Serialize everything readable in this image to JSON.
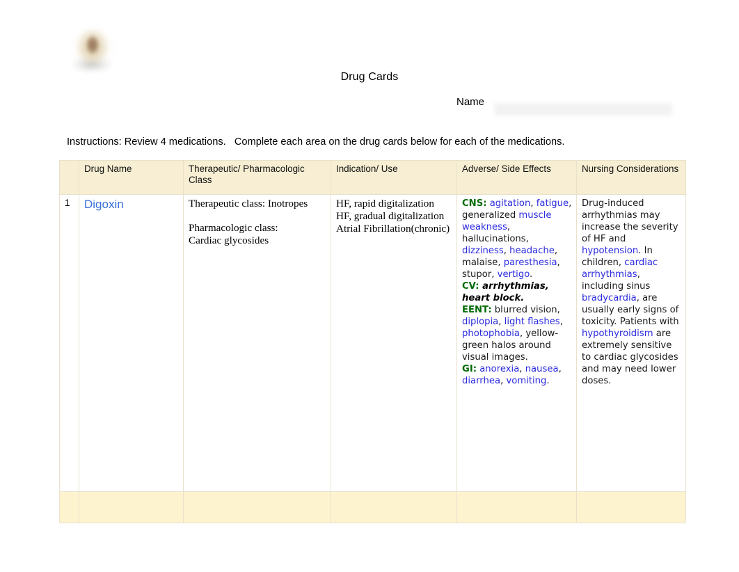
{
  "document": {
    "title": "Drug Cards",
    "name_label": "Name",
    "name_value": "",
    "instructions": "Instructions: Review 4 medications.   Complete each area on the drug cards below for each of the medications.",
    "logo_alt": "school-logo"
  },
  "colors": {
    "header_bg": "#f7eed3",
    "footer_bg": "#fdf3cf",
    "border": "#e8e2cd",
    "link_blue": "#2b2be0",
    "drug_link_blue": "#3a6fd8",
    "system_green": "#046b06"
  },
  "table": {
    "headers": [
      "",
      "Drug Name",
      "Therapeutic/ Pharmacologic Class",
      "Indication/ Use",
      "Adverse/ Side Effects",
      "Nursing Considerations"
    ],
    "rows": [
      {
        "number": "1",
        "drug_name": "Digoxin",
        "therapeutic_class_label": "Therapeutic class: Inotropes",
        "pharmacologic_class_label": "Pharmacologic class:",
        "pharmacologic_class_value": "Cardiac glycosides",
        "indications": [
          "HF, rapid digitalization",
          "HF, gradual digitalization",
          "Atrial Fibrillation(chronic)"
        ],
        "adverse_effects": {
          "cns": {
            "system": "CNS:",
            "items": [
              {
                "text": "agitation",
                "style": "link"
              },
              {
                "text": ", ",
                "style": "plain"
              },
              {
                "text": "fatigue",
                "style": "link"
              },
              {
                "text": ", generalized ",
                "style": "plain"
              },
              {
                "text": "muscle weakness",
                "style": "link"
              },
              {
                "text": ", hallucinations, ",
                "style": "plain"
              },
              {
                "text": "dizziness",
                "style": "link"
              },
              {
                "text": ", ",
                "style": "plain"
              },
              {
                "text": "headache",
                "style": "link"
              },
              {
                "text": ", malaise, ",
                "style": "plain"
              },
              {
                "text": "paresthesia",
                "style": "link"
              },
              {
                "text": ", stupor, ",
                "style": "plain"
              },
              {
                "text": "vertigo",
                "style": "link"
              },
              {
                "text": ".",
                "style": "plain"
              }
            ]
          },
          "cv": {
            "system": "CV:",
            "items": [
              {
                "text": " arrhythmias, heart block.",
                "style": "bolditalic"
              }
            ]
          },
          "eent": {
            "system": "EENT:",
            "items": [
              {
                "text": " blurred vision, ",
                "style": "plain"
              },
              {
                "text": "diplopia",
                "style": "link"
              },
              {
                "text": ", ",
                "style": "plain"
              },
              {
                "text": "light flashes",
                "style": "link"
              },
              {
                "text": ", ",
                "style": "plain"
              },
              {
                "text": "photophobia",
                "style": "link"
              },
              {
                "text": ", yellow-green halos around visual images.",
                "style": "plain"
              }
            ]
          },
          "gi": {
            "system": "GI:",
            "items": [
              {
                "text": " ",
                "style": "plain"
              },
              {
                "text": "anorexia",
                "style": "link"
              },
              {
                "text": ", ",
                "style": "plain"
              },
              {
                "text": "nausea",
                "style": "link"
              },
              {
                "text": ", ",
                "style": "plain"
              },
              {
                "text": "diarrhea",
                "style": "link"
              },
              {
                "text": ", ",
                "style": "plain"
              },
              {
                "text": "vomiting",
                "style": "link"
              },
              {
                "text": ".",
                "style": "plain"
              }
            ]
          }
        },
        "nursing_considerations": [
          {
            "text": "Drug-induced arrhythmias may increase the severity of HF and ",
            "style": "plain"
          },
          {
            "text": "hypotension",
            "style": "link"
          },
          {
            "text": ". In children, ",
            "style": "plain"
          },
          {
            "text": "cardiac arrhythmias",
            "style": "link"
          },
          {
            "text": ", including sinus ",
            "style": "plain"
          },
          {
            "text": "bradycardia",
            "style": "link"
          },
          {
            "text": ", are usually early signs of toxicity. Patients with ",
            "style": "plain"
          },
          {
            "text": "hypothyroidism",
            "style": "link"
          },
          {
            "text": " are extremely sensitive to cardiac glycosides and may need lower doses.",
            "style": "plain"
          }
        ]
      }
    ],
    "footer_cells": [
      "",
      "",
      "",
      "",
      "",
      ""
    ]
  }
}
